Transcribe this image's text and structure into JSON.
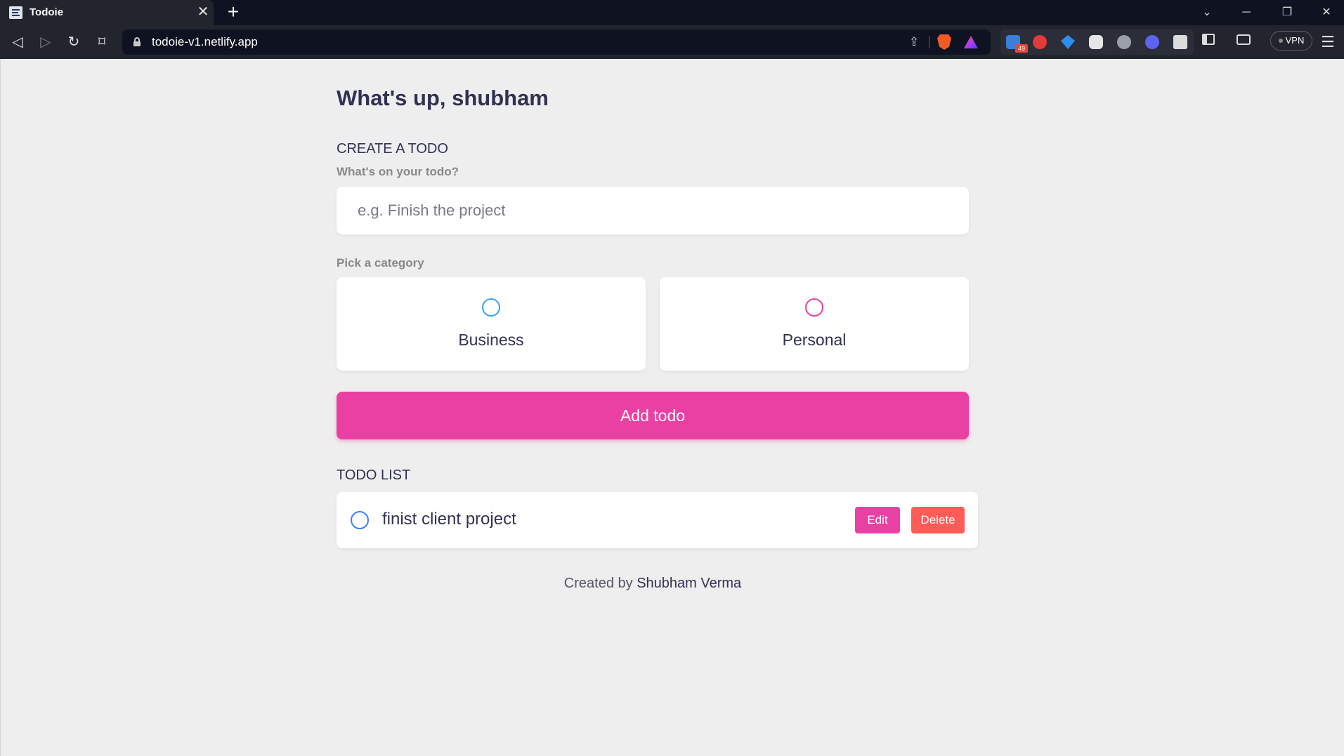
{
  "browser": {
    "tab_title": "Todoie",
    "url": "todoie-v1.netlify.app",
    "extension_badge": "49",
    "vpn_label": "VPN"
  },
  "app": {
    "greeting": "What's up, shubham",
    "create_section_title": "CREATE A TODO",
    "todo_input_label": "What's on your todo?",
    "todo_input_placeholder": "e.g. Finish the project",
    "todo_input_value": "",
    "category_label": "Pick a category",
    "categories": [
      {
        "label": "Business",
        "color": "#3aa3f7",
        "selected": false
      },
      {
        "label": "Personal",
        "color": "#ea40a4",
        "selected": false
      }
    ],
    "add_button_label": "Add todo",
    "list_section_title": "TODO LIST",
    "todos": [
      {
        "text": "finist client project",
        "done": false,
        "category_color": "#3a82f7",
        "edit_label": "Edit",
        "delete_label": "Delete"
      }
    ],
    "footer_prefix": "Created by",
    "footer_author": "Shubham Verma"
  },
  "colors": {
    "accent": "#ea40a4",
    "danger": "#ff5b57",
    "text_dark": "#313154",
    "background": "#eeeeee"
  }
}
